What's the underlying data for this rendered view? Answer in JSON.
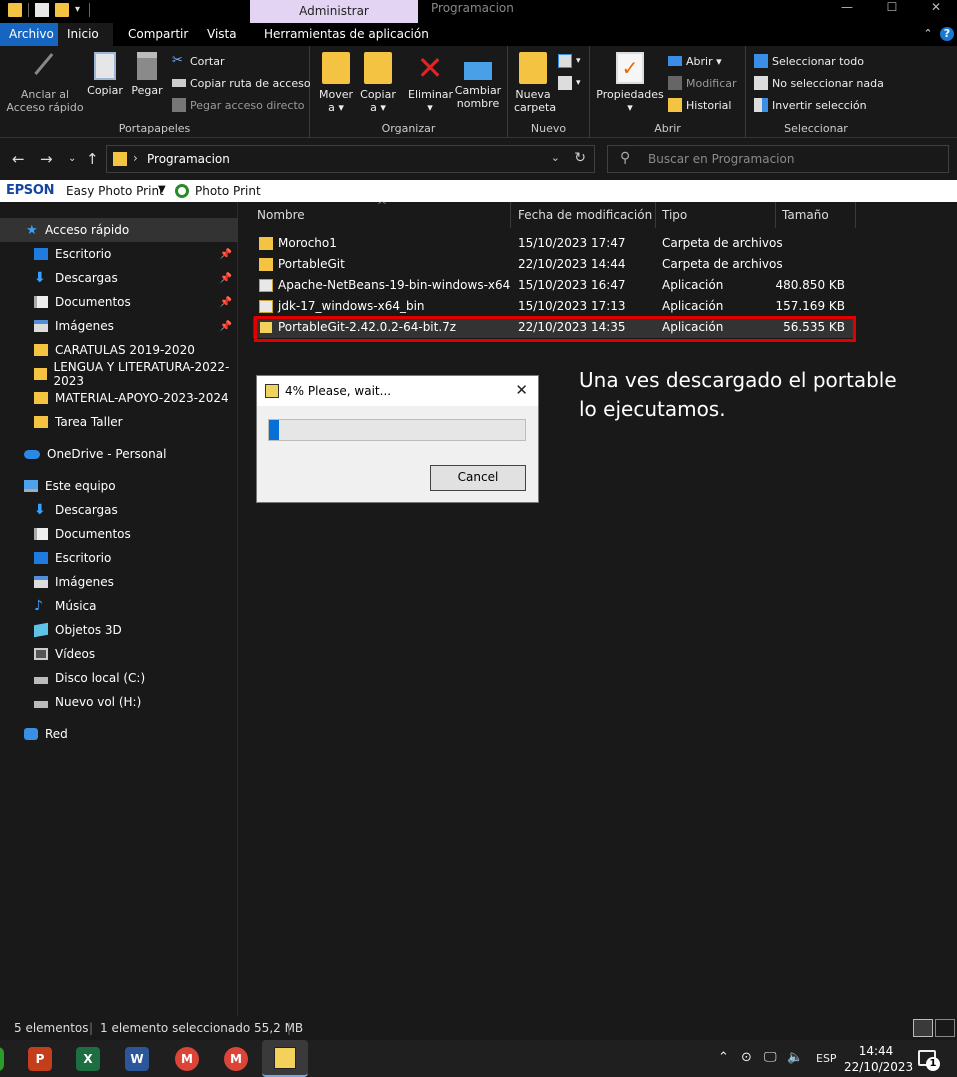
{
  "window": {
    "title": "Programacion",
    "context_tab": "Administrar",
    "minimize": "—",
    "maximize": "☐",
    "close": "✕"
  },
  "ribbon_tabs": [
    {
      "label": "Archivo"
    },
    {
      "label": "Inicio"
    },
    {
      "label": "Compartir"
    },
    {
      "label": "Vista"
    },
    {
      "label": "Herramientas de aplicación"
    }
  ],
  "ribbon": {
    "portapapeles": {
      "label": "Portapapeles",
      "pin": "Anclar al\nAcceso rápido",
      "copy": "Copiar",
      "paste": "Pegar",
      "cut": "Cortar",
      "copy_path": "Copiar ruta de acceso",
      "paste_shortcut": "Pegar acceso directo"
    },
    "organizar": {
      "label": "Organizar",
      "move": "Mover\na ▾",
      "copy_to": "Copiar\na ▾",
      "delete": "Eliminar\n▾",
      "rename": "Cambiar\nnombre"
    },
    "nuevo": {
      "label": "Nuevo",
      "new_folder": "Nueva\ncarpeta"
    },
    "abrir": {
      "label": "Abrir",
      "properties": "Propiedades\n▾",
      "open": "Abrir ▾",
      "edit": "Modificar",
      "history": "Historial"
    },
    "seleccionar": {
      "label": "Seleccionar",
      "select_all": "Seleccionar todo",
      "select_none": "No seleccionar nada",
      "invert": "Invertir selección"
    }
  },
  "address": {
    "path": "Programacion",
    "search_placeholder": "Buscar en Programacion"
  },
  "epson": {
    "logo": "EPSON",
    "easy_photo_print": "Easy Photo Print",
    "photo_print": "Photo Print"
  },
  "sidebar": {
    "quick_access": "Acceso rápido",
    "quick_items": [
      {
        "label": "Escritorio",
        "pinned": true,
        "icon": "desktop-icon"
      },
      {
        "label": "Descargas",
        "pinned": true,
        "icon": "downloads-icon"
      },
      {
        "label": "Documentos",
        "pinned": true,
        "icon": "documents-icon"
      },
      {
        "label": "Imágenes",
        "pinned": true,
        "icon": "pictures-icon"
      },
      {
        "label": "CARATULAS 2019-2020",
        "pinned": false,
        "icon": "folder-icon"
      },
      {
        "label": "LENGUA Y LITERATURA-2022-2023",
        "pinned": false,
        "icon": "folder-icon"
      },
      {
        "label": "MATERIAL-APOYO-2023-2024",
        "pinned": false,
        "icon": "folder-icon"
      },
      {
        "label": "Tarea Taller",
        "pinned": false,
        "icon": "folder-icon"
      }
    ],
    "onedrive": "OneDrive - Personal",
    "this_pc": "Este equipo",
    "pc_items": [
      {
        "label": "Descargas",
        "icon": "downloads-icon"
      },
      {
        "label": "Documentos",
        "icon": "documents-icon"
      },
      {
        "label": "Escritorio",
        "icon": "desktop-icon"
      },
      {
        "label": "Imágenes",
        "icon": "pictures-icon"
      },
      {
        "label": "Música",
        "icon": "music-icon"
      },
      {
        "label": "Objetos 3D",
        "icon": "3d-objects-icon"
      },
      {
        "label": "Vídeos",
        "icon": "videos-icon"
      },
      {
        "label": "Disco local (C:)",
        "icon": "drive-icon"
      },
      {
        "label": "Nuevo vol (H:)",
        "icon": "drive-icon"
      }
    ],
    "network": "Red"
  },
  "columns": {
    "name": "Nombre",
    "date": "Fecha de modificación",
    "type": "Tipo",
    "size": "Tamaño"
  },
  "files": [
    {
      "name": "Morocho1",
      "date": "15/10/2023 17:47",
      "type": "Carpeta de archivos",
      "size": "",
      "icon": "folder-icon"
    },
    {
      "name": "PortableGit",
      "date": "22/10/2023 14:44",
      "type": "Carpeta de archivos",
      "size": "",
      "icon": "folder-icon"
    },
    {
      "name": "Apache-NetBeans-19-bin-windows-x64",
      "date": "15/10/2023 16:47",
      "type": "Aplicación",
      "size": "480.850 KB",
      "icon": "installer-icon"
    },
    {
      "name": "jdk-17_windows-x64_bin",
      "date": "15/10/2023 17:13",
      "type": "Aplicación",
      "size": "157.169 KB",
      "icon": "java-icon"
    },
    {
      "name": "PortableGit-2.42.0.2-64-bit.7z",
      "date": "22/10/2023 14:35",
      "type": "Aplicación",
      "size": "56.535 KB",
      "icon": "7z-sfx-icon"
    }
  ],
  "dialog": {
    "title": "4% Please, wait...",
    "progress": 0.04,
    "cancel": "Cancel"
  },
  "annotation": "Una ves descargado el portable lo ejecutamos.",
  "status": {
    "count": "5 elementos",
    "selection": "1 elemento seleccionado  55,2 MB"
  },
  "taskbar": {
    "apps": [
      "powerpoint-icon",
      "excel-icon",
      "word-icon",
      "chrome-icon",
      "chrome-profile-icon",
      "7z-sfx-icon"
    ],
    "lang": "ESP",
    "time": "14:44",
    "date": "22/10/2023",
    "notifications": "1"
  },
  "colors": {
    "accent": "#1666c1",
    "highlight_box": "#e00000",
    "progress": "#0670d6"
  }
}
